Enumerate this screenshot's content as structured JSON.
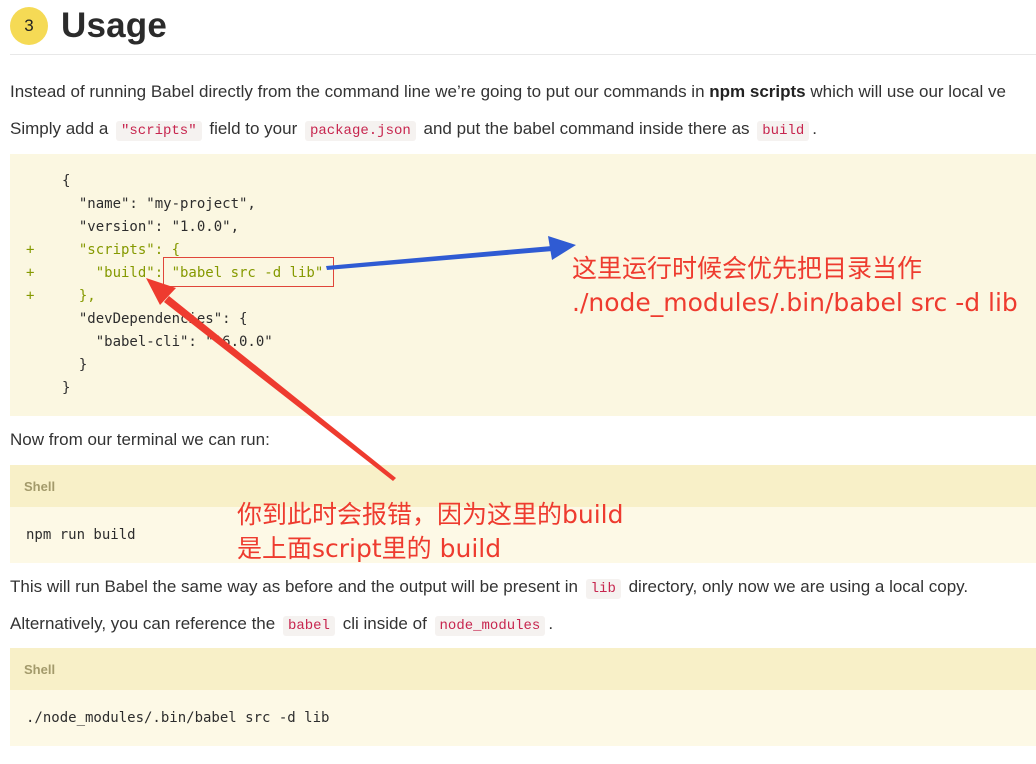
{
  "heading": {
    "step_number": "3",
    "title": "Usage"
  },
  "intro": {
    "p1_before": "Instead of running Babel directly from the command line we’re going to put our commands in ",
    "p1_bold": "npm scripts",
    "p1_after": " which will use our local ve",
    "p2_part1": "Simply add a ",
    "p2_code1": "\"scripts\"",
    "p2_part2": " field to your ",
    "p2_code2": "package.json",
    "p2_part3": " and put the babel command inside there as ",
    "p2_code3": "build",
    "p2_part4": "."
  },
  "json_code": {
    "lines": [
      {
        "prefix": "",
        "text": "{"
      },
      {
        "prefix": "",
        "text": "  \"name\": \"my-project\","
      },
      {
        "prefix": "",
        "text": "  \"version\": \"1.0.0\","
      },
      {
        "prefix": "+",
        "text": "  \"scripts\": {"
      },
      {
        "prefix": "+",
        "text": "    \"build\": \"babel src -d lib\""
      },
      {
        "prefix": "+",
        "text": "  },"
      },
      {
        "prefix": "",
        "text": "  \"devDependencies\": {"
      },
      {
        "prefix": "",
        "text": "    \"babel-cli\": \"^6.0.0\""
      },
      {
        "prefix": "",
        "text": "  }"
      },
      {
        "prefix": "",
        "text": "}"
      }
    ]
  },
  "terminal_text": "Now from our terminal we can run:",
  "shell1": {
    "label": "Shell",
    "command": "npm run build"
  },
  "after": {
    "p1_part1": "This will run Babel the same way as before and the output will be present in ",
    "p1_code": "lib",
    "p1_part2": " directory, only now we are using a local copy.",
    "p2_part1": "Alternatively, you can reference the ",
    "p2_code1": "babel",
    "p2_part2": " cli inside of ",
    "p2_code2": "node_modules",
    "p2_part3": "."
  },
  "shell2": {
    "label": "Shell",
    "command": "./node_modules/.bin/babel src -d lib"
  },
  "annotations": {
    "right_line1": "这里运行时候会优先把目录当作",
    "right_line2": "./node_modules/.bin/babel src -d lib",
    "bottom_line1": "你到此时会报错，因为这里的build",
    "bottom_line2": "是上面script里的 build"
  },
  "colors": {
    "badge": "#f5da55",
    "annotation_red": "#ee3b2f",
    "arrow_blue": "#2f5bd3",
    "code_bg": "#fbf7e1",
    "inline_code": "#c7254e"
  }
}
